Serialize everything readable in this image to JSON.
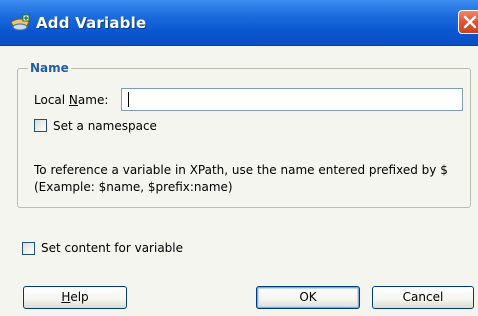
{
  "window": {
    "title": "Add Variable"
  },
  "name_group": {
    "legend": "Name",
    "local_name_label_prefix": "Local ",
    "local_name_label_mnemonic": "N",
    "local_name_label_suffix": "ame:",
    "local_name_value": "",
    "set_namespace_label": "Set a namespace",
    "set_namespace_checked": false,
    "info_line1": "To reference a variable in XPath, use the name entered prefixed by $",
    "info_line2": "(Example: $name, $prefix:name)"
  },
  "content": {
    "set_content_label": "Set content for variable",
    "set_content_checked": false
  },
  "buttons": {
    "help_mnemonic": "H",
    "help_rest": "elp",
    "ok_label": "OK",
    "cancel_label": "Cancel"
  }
}
